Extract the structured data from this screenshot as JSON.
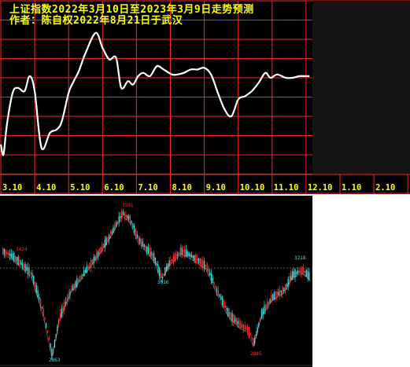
{
  "title_lines": [
    "上证指数2022年3月10日至2023年3月9日走势预测",
    "作者：陈自权2022年8月21日于武汉"
  ],
  "colors": {
    "background": "#000000",
    "grid": "#ff2020",
    "forecast_line": "#ffffff",
    "title": "#ffff00",
    "tick_label": "#ffff00",
    "candle_up": "#ff3030",
    "candle_down": "#40e0e0"
  },
  "chart_data": [
    {
      "type": "line",
      "name": "forecast-chart",
      "x_ticks": [
        "3.10",
        "4.10",
        "5.10",
        "6.10",
        "7.10",
        "8.10",
        "9.10",
        "10.10",
        "11.10",
        "12.10",
        "1.10",
        "2.10"
      ],
      "grid": true,
      "series": [
        {
          "x": [
            0.0,
            0.08,
            0.18,
            0.35,
            0.5,
            0.7,
            0.85,
            1.0,
            1.2,
            1.45,
            1.65,
            1.8,
            2.0,
            2.15,
            2.3,
            2.5,
            2.8,
            3.0,
            3.2,
            3.4,
            3.55,
            3.75,
            3.9,
            4.05,
            4.2,
            4.4,
            4.6,
            4.8,
            5.05,
            5.2,
            5.4,
            5.6,
            5.8,
            6.0,
            6.2,
            6.4,
            6.6,
            6.8,
            7.0,
            7.2,
            7.4,
            7.6,
            7.8,
            7.95,
            8.15,
            8.4,
            8.6,
            8.8,
            9.0,
            9.1
          ],
          "y": [
            0.18,
            0.12,
            0.3,
            0.49,
            0.52,
            0.5,
            0.59,
            0.5,
            0.16,
            0.25,
            0.27,
            0.32,
            0.49,
            0.56,
            0.62,
            0.73,
            0.85,
            0.76,
            0.69,
            0.7,
            0.52,
            0.56,
            0.54,
            0.59,
            0.61,
            0.59,
            0.65,
            0.63,
            0.6,
            0.6,
            0.61,
            0.63,
            0.63,
            0.64,
            0.6,
            0.49,
            0.39,
            0.35,
            0.45,
            0.47,
            0.5,
            0.55,
            0.61,
            0.58,
            0.6,
            0.58,
            0.58,
            0.59,
            0.59,
            0.59
          ]
        }
      ]
    },
    {
      "type": "candlestick",
      "name": "actual-index-chart",
      "annotations": [
        "3424",
        "2863",
        "3591",
        "3016",
        "2885",
        "3218"
      ],
      "reference_line": true
    }
  ]
}
